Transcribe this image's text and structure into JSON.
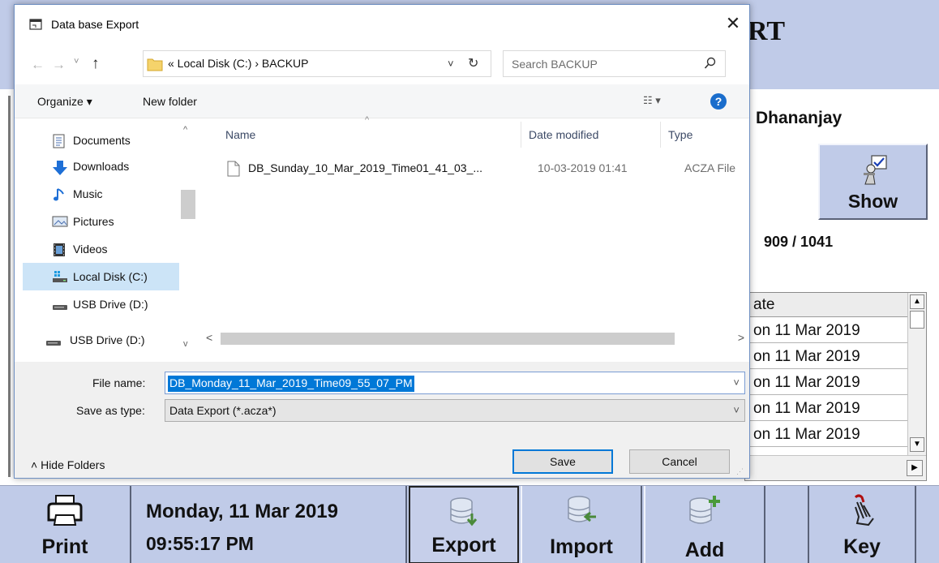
{
  "app": {
    "title_fragment": "RT",
    "user_name": "Dhananjay",
    "show_label": "Show",
    "count_text": "909 /  1041",
    "grid": {
      "header": "ate",
      "rows": [
        "on 11 Mar 2019",
        "on 11 Mar 2019",
        "on 11 Mar 2019",
        "on 11 Mar 2019",
        "on 11 Mar 2019"
      ]
    },
    "toolbar": {
      "print": "Print",
      "date": "Monday, 11 Mar 2019",
      "time": "09:55:17 PM",
      "export": "Export",
      "import": "Import",
      "add": "Add",
      "key": "Key"
    }
  },
  "dialog": {
    "title": "Data base Export",
    "close": "✕",
    "breadcrumb": "«  Local Disk (C:)  ›  BACKUP",
    "search_placeholder": "Search BACKUP",
    "organize": "Organize ▾",
    "new_folder": "New folder",
    "nav_items": [
      {
        "label": "Documents",
        "icon": "documents-icon"
      },
      {
        "label": "Downloads",
        "icon": "downloads-icon"
      },
      {
        "label": "Music",
        "icon": "music-icon"
      },
      {
        "label": "Pictures",
        "icon": "pictures-icon"
      },
      {
        "label": "Videos",
        "icon": "videos-icon"
      },
      {
        "label": "Local Disk (C:)",
        "icon": "local-disk-icon"
      },
      {
        "label": "USB Drive (D:)",
        "icon": "usb-drive-icon"
      },
      {
        "label": "USB Drive (D:)",
        "icon": "usb-drive-icon"
      }
    ],
    "columns": {
      "name": "Name",
      "date_modified": "Date modified",
      "type": "Type"
    },
    "files": [
      {
        "name": "DB_Sunday_10_Mar_2019_Time01_41_03_...",
        "date": "10-03-2019 01:41",
        "type": "ACZA File"
      }
    ],
    "file_name_label": "File name:",
    "file_name_value": "DB_Monday_11_Mar_2019_Time09_55_07_PM",
    "save_type_label": "Save as type:",
    "save_type_value": "Data Export (*.acza*)",
    "hide_folders": "Hide Folders",
    "save": "Save",
    "cancel": "Cancel"
  },
  "colors": {
    "app_background": "#c0cbe8",
    "selection": "#0078d7",
    "nav_selected": "#cce4f7"
  }
}
